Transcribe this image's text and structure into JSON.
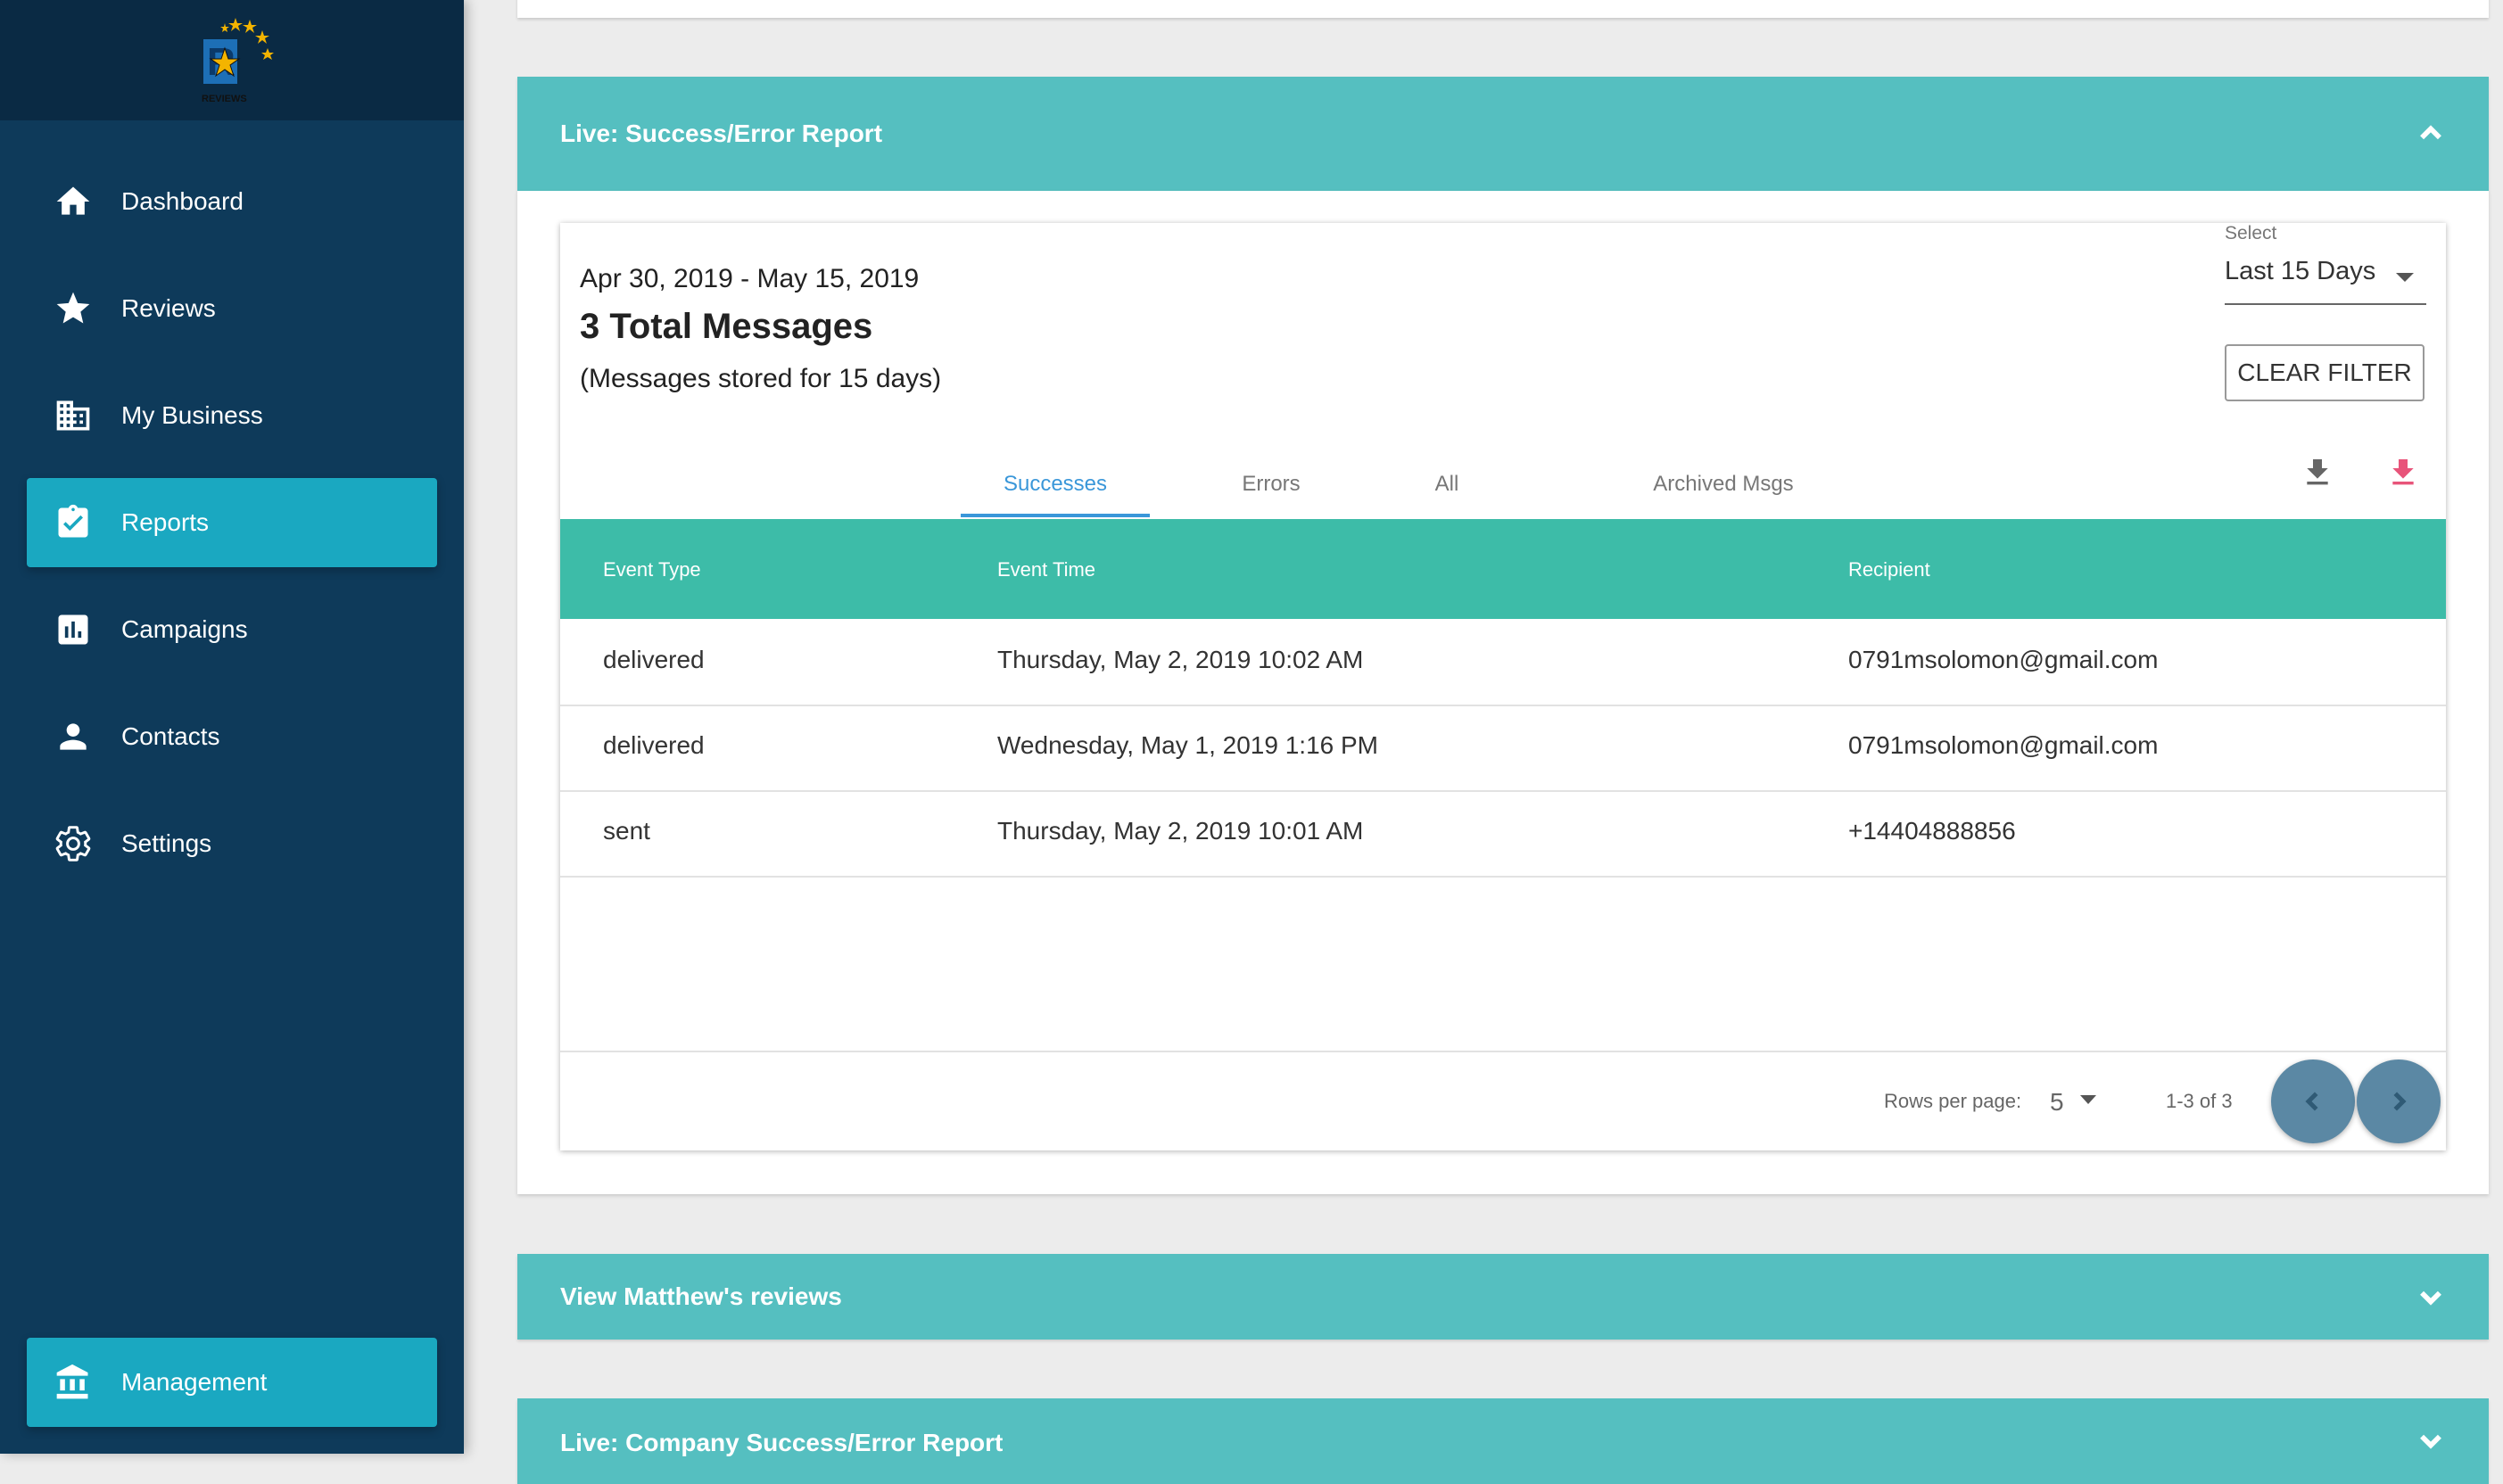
{
  "sidebar": {
    "logo_text": "REVIEWS",
    "items": [
      {
        "label": "Dashboard",
        "icon": "home-icon"
      },
      {
        "label": "Reviews",
        "icon": "star-icon"
      },
      {
        "label": "My Business",
        "icon": "building-icon"
      },
      {
        "label": "Reports",
        "icon": "clipboard-check-icon",
        "active": true
      },
      {
        "label": "Campaigns",
        "icon": "bar-chart-icon"
      },
      {
        "label": "Contacts",
        "icon": "person-icon"
      },
      {
        "label": "Settings",
        "icon": "gear-icon"
      }
    ],
    "management": {
      "label": "Management",
      "icon": "bank-icon"
    }
  },
  "report_panel": {
    "title": "Live: Success/Error Report",
    "date_range": "Apr 30, 2019 - May 15, 2019",
    "total_messages": "3 Total Messages",
    "stored_note": "(Messages stored for 15 days)",
    "select": {
      "label": "Select",
      "value": "Last 15 Days"
    },
    "clear_filter_label": "CLEAR FILTER",
    "tabs": [
      {
        "label": "Successes",
        "active": true
      },
      {
        "label": "Errors"
      },
      {
        "label": "All"
      },
      {
        "label": "Archived Msgs"
      }
    ],
    "table": {
      "headers": [
        "Event Type",
        "Event Time",
        "Recipient"
      ],
      "rows": [
        [
          "delivered",
          "Thursday, May 2, 2019 10:02 AM",
          "0791msolomon@gmail.com"
        ],
        [
          "delivered",
          "Wednesday, May 1, 2019 1:16 PM",
          "0791msolomon@gmail.com"
        ],
        [
          "sent",
          "Thursday, May 2, 2019 10:01 AM",
          "+14404888856"
        ]
      ]
    },
    "pagination": {
      "rows_per_page_label": "Rows per page:",
      "rows_per_page": "5",
      "range": "1-3 of 3"
    }
  },
  "panels": [
    {
      "title": "View Matthew's reviews"
    },
    {
      "title": "Live: Company Success/Error Report"
    }
  ],
  "colors": {
    "sidebar_bg": "#0e3a5a",
    "active_nav": "#1aa8c1",
    "panel_header": "#55bfc0",
    "table_header": "#3dbca8",
    "tab_active": "#3a97d9",
    "download_red": "#e8547a"
  }
}
